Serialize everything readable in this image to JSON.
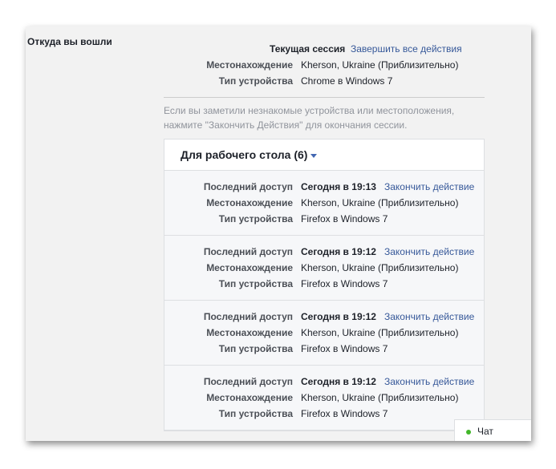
{
  "section_title": "Откуда вы вошли",
  "current": {
    "label": "Текущая сессия",
    "end_all": "Завершить все действия",
    "location_label": "Местонахождение",
    "location": "Kherson, Ukraine (Приблизительно)",
    "device_label": "Тип устройства",
    "device": "Chrome в Windows 7"
  },
  "note": "Если вы заметили незнакомые устройства или местоположения, нажмите \"Закончить Действия\" для окончания сессии.",
  "desktop": {
    "title": "Для рабочего стола (6)",
    "sessions": [
      {
        "last_label": "Последний доступ",
        "last": "Сегодня в 19:13",
        "end": "Закончить действие",
        "location_label": "Местонахождение",
        "location": "Kherson, Ukraine (Приблизительно)",
        "device_label": "Тип устройства",
        "device": "Firefox в Windows 7"
      },
      {
        "last_label": "Последний доступ",
        "last": "Сегодня в 19:12",
        "end": "Закончить действие",
        "location_label": "Местонахождение",
        "location": "Kherson, Ukraine (Приблизительно)",
        "device_label": "Тип устройства",
        "device": "Firefox в Windows 7"
      },
      {
        "last_label": "Последний доступ",
        "last": "Сегодня в 19:12",
        "end": "Закончить действие",
        "location_label": "Местонахождение",
        "location": "Kherson, Ukraine (Приблизительно)",
        "device_label": "Тип устройства",
        "device": "Firefox в Windows 7"
      },
      {
        "last_label": "Последний доступ",
        "last": "Сегодня в 19:12",
        "end": "Закончить действие",
        "location_label": "Местонахождение",
        "location": "Kherson, Ukraine (Приблизительно)",
        "device_label": "Тип устройства",
        "device": "Firefox в Windows 7"
      }
    ]
  },
  "chat": {
    "label": "Чат"
  }
}
